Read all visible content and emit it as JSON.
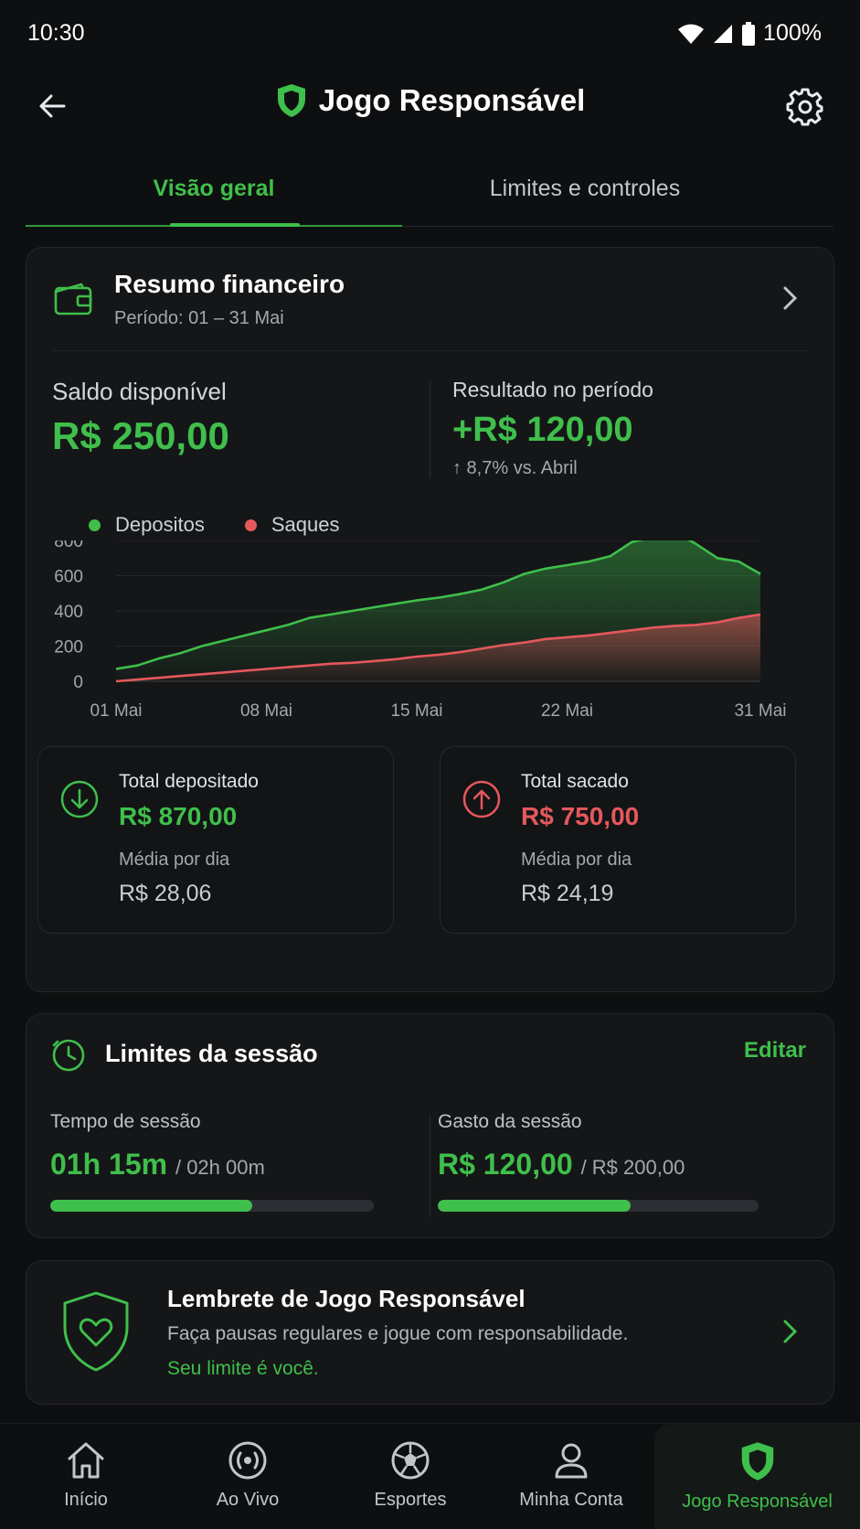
{
  "status": {
    "time": "10:30",
    "battery": "100%"
  },
  "header": {
    "title": "Jogo Responsável"
  },
  "tabs": [
    {
      "label": "Visão geral"
    },
    {
      "label": "Limites e controles"
    }
  ],
  "financial": {
    "title": "Resumo financeiro",
    "period": "Período: 01 – 31 Mai",
    "balance_label": "Saldo disponível",
    "balance_value": "R$ 250,00",
    "result_label": "Resultado no período",
    "result_value": "+R$ 120,00",
    "result_delta": "↑ 8,7% vs. Abril",
    "legend": {
      "deposits": "Depositos",
      "withdrawals": "Saques"
    },
    "deposited_label": "Total depositado",
    "deposited_value": "R$ 870,00",
    "deposited_avg_label": "Média por dia",
    "deposited_avg_value": "R$ 28,06",
    "withdrawn_label": "Total sacado",
    "withdrawn_value": "R$ 750,00",
    "withdrawn_avg_label": "Média por dia",
    "withdrawn_avg_value": "R$ 24,19"
  },
  "chart_data": {
    "type": "area",
    "x": [
      1,
      2,
      3,
      4,
      5,
      6,
      7,
      8,
      9,
      10,
      11,
      12,
      13,
      14,
      15,
      16,
      17,
      18,
      19,
      20,
      21,
      22,
      23,
      24,
      25,
      26,
      27,
      28,
      29,
      30,
      31
    ],
    "x_ticks": [
      "01 Mai",
      "08 Mai",
      "15 Mai",
      "22 Mai",
      "31 Mai"
    ],
    "y_ticks": [
      "0",
      "200",
      "400",
      "600",
      "800"
    ],
    "ylim": [
      0,
      800
    ],
    "series": [
      {
        "name": "Depositos",
        "color": "#3fbf4b",
        "values": [
          70,
          90,
          130,
          160,
          200,
          230,
          260,
          290,
          320,
          360,
          380,
          400,
          420,
          440,
          460,
          475,
          495,
          520,
          560,
          610,
          640,
          660,
          680,
          710,
          790,
          820,
          850,
          780,
          700,
          680,
          610
        ]
      },
      {
        "name": "Saques",
        "color": "#e5585c",
        "values": [
          0,
          10,
          20,
          30,
          40,
          50,
          60,
          70,
          80,
          90,
          100,
          105,
          115,
          125,
          140,
          150,
          165,
          185,
          205,
          220,
          240,
          250,
          260,
          275,
          290,
          305,
          315,
          320,
          335,
          360,
          380
        ]
      }
    ]
  },
  "session": {
    "title": "Limites da sessão",
    "edit": "Editar",
    "time_label": "Tempo de sessão",
    "time_value": "01h 15m",
    "time_limit": "/ 02h 00m",
    "time_progress": 0.625,
    "spend_label": "Gasto da sessão",
    "spend_value": "R$ 120,00",
    "spend_limit": "/ R$ 200,00",
    "spend_progress": 0.6
  },
  "reminder": {
    "title": "Lembrete de Jogo Responsável",
    "text": "Faça pausas regulares e jogue com responsabilidade.",
    "link": "Seu limite é você."
  },
  "nav": [
    {
      "label": "Início",
      "icon": "home-icon"
    },
    {
      "label": "Ao Vivo",
      "icon": "live-icon"
    },
    {
      "label": "Esportes",
      "icon": "soccer-ball-icon"
    },
    {
      "label": "Minha Conta",
      "icon": "user-icon"
    },
    {
      "label": "Jogo Responsável",
      "icon": "shield-icon"
    }
  ],
  "colors": {
    "accent": "#3fbf4b",
    "negative": "#e5585c",
    "background": "#0e0f10"
  }
}
